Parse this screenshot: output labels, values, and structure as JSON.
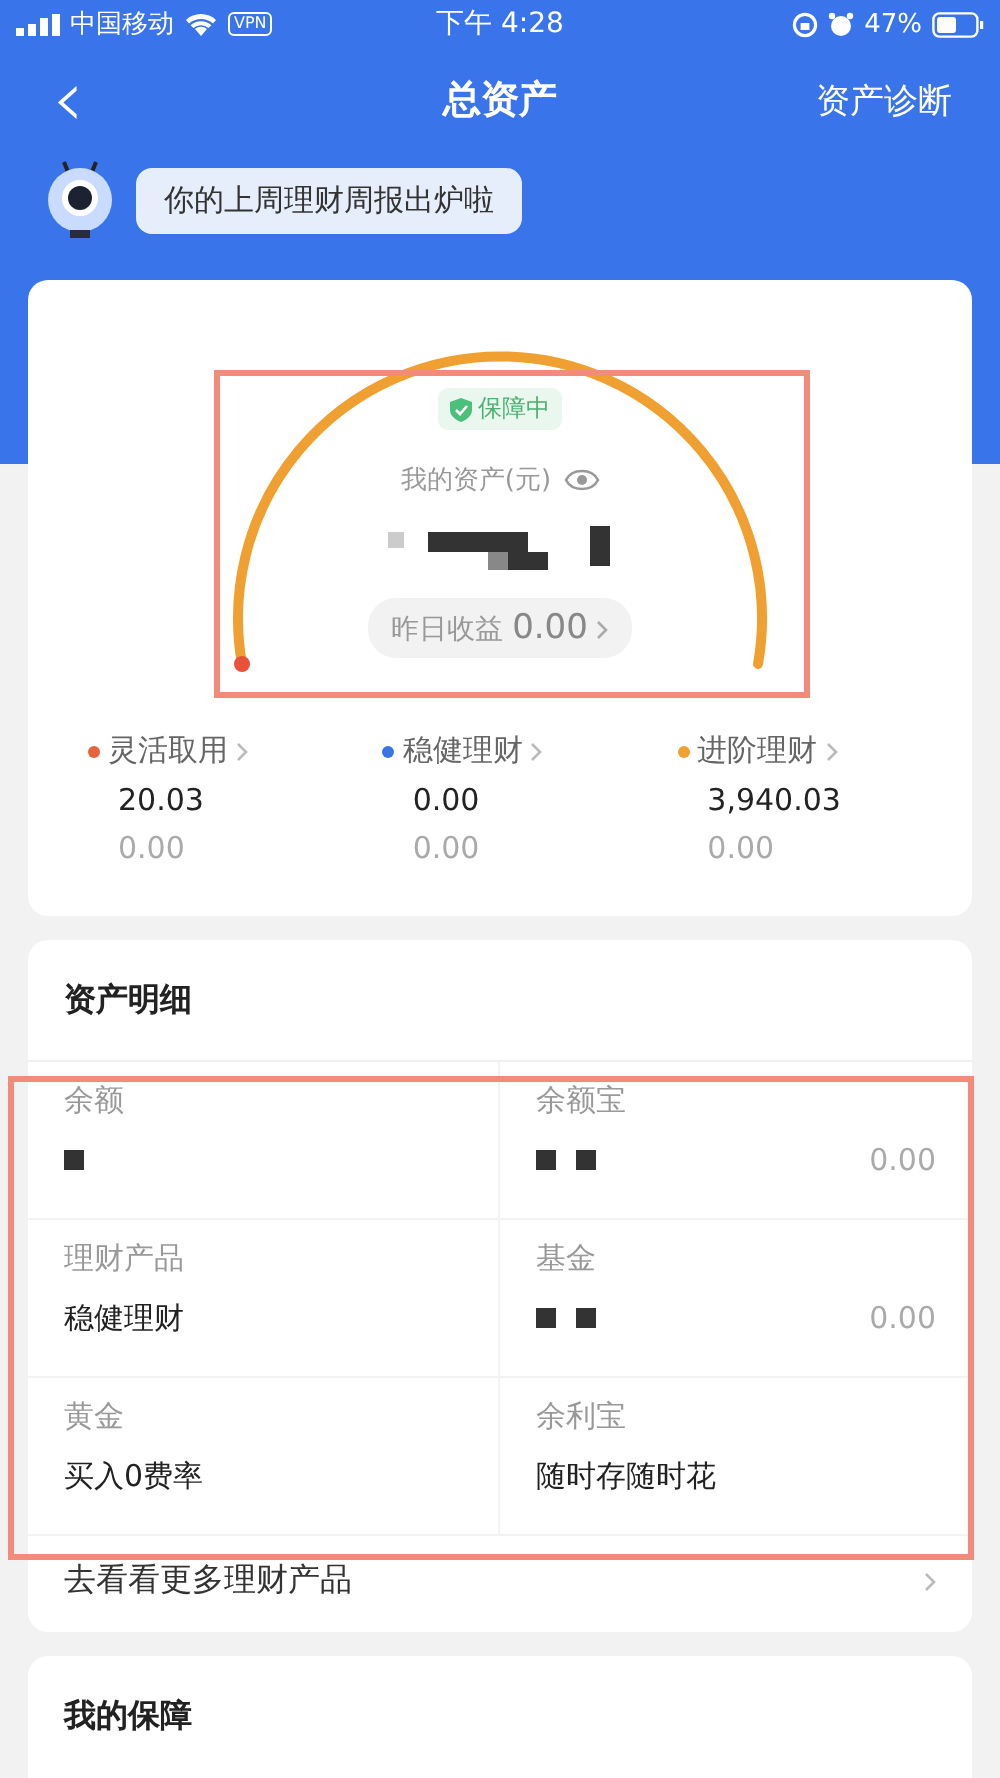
{
  "status_bar": {
    "carrier": "中国移动",
    "vpn": "VPN",
    "time": "下午 4:28",
    "battery": "47%"
  },
  "nav": {
    "back": "‹",
    "title": "总资产",
    "action": "资产诊断"
  },
  "notice": {
    "text": "你的上周理财周报出炉啦"
  },
  "overview": {
    "badge": "保障中",
    "label": "我的资产(元)",
    "amount_redacted": true,
    "yesterday_label": "昨日收益",
    "yesterday_value": "0.00",
    "categories": [
      {
        "name": "灵活取用",
        "color": "#e8623a",
        "amount": "20.03",
        "yesterday": "0.00"
      },
      {
        "name": "稳健理财",
        "color": "#3b73e8",
        "amount": "0.00",
        "yesterday": "0.00"
      },
      {
        "name": "进阶理财",
        "color": "#f0a030",
        "amount": "3,940.03",
        "yesterday": "0.00"
      }
    ]
  },
  "details": {
    "title": "资产明细",
    "cells": [
      {
        "label": "余额",
        "value_redacted": true
      },
      {
        "label": "余额宝",
        "value_redacted": true,
        "amount": "0.00"
      },
      {
        "label": "理财产品",
        "value": "稳健理财"
      },
      {
        "label": "基金",
        "value_redacted": true,
        "amount": "0.00"
      },
      {
        "label": "黄金",
        "value": "买入0费率"
      },
      {
        "label": "余利宝",
        "value": "随时存随时花"
      }
    ],
    "more": "去看看更多理财产品"
  },
  "protection": {
    "title": "我的保障"
  }
}
